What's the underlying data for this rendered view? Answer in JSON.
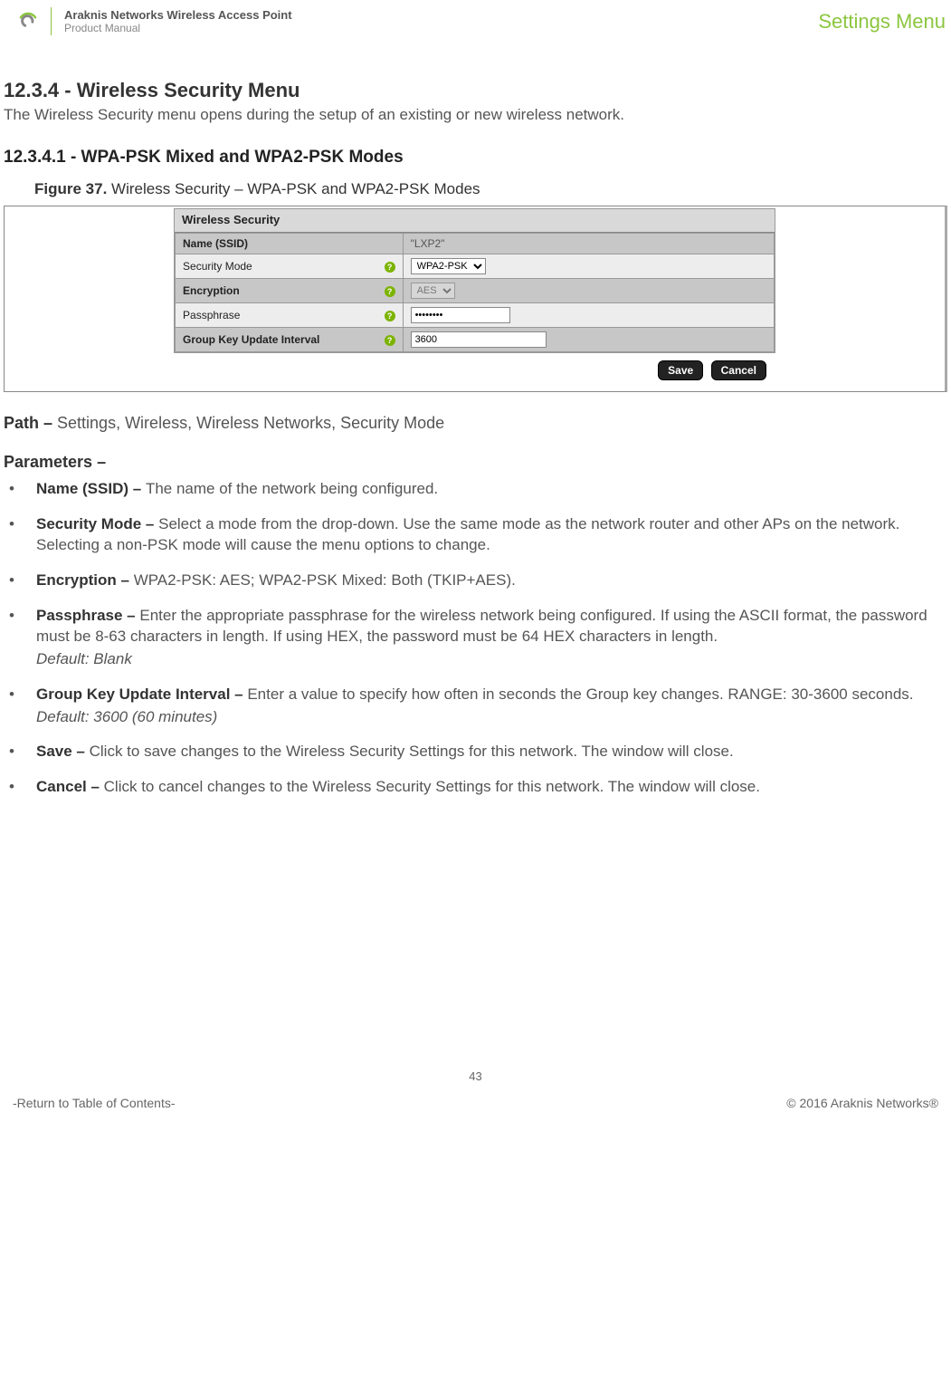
{
  "header": {
    "product_title": "Araknis Networks Wireless Access Point",
    "product_sub": "Product Manual",
    "section_label": "Settings Menu"
  },
  "section": {
    "heading": "12.3.4 - Wireless Security Menu",
    "intro": "The Wireless Security menu opens during the setup of an existing or new wireless network.",
    "sub_heading": "12.3.4.1 - WPA-PSK Mixed and WPA2-PSK Modes",
    "figure_prefix": "Figure 37.",
    "figure_caption": "Wireless Security – WPA-PSK and WPA2-PSK Modes"
  },
  "panel": {
    "title": "Wireless Security",
    "rows": {
      "ssid_label": "Name (SSID)",
      "ssid_value": "\"LXP2\"",
      "secmode_label": "Security Mode",
      "secmode_value": "WPA2-PSK",
      "enc_label": "Encryption",
      "enc_value": "AES",
      "pass_label": "Passphrase",
      "pass_value": "••••••••",
      "gku_label": "Group Key Update Interval",
      "gku_value": "3600"
    },
    "save_label": "Save",
    "cancel_label": "Cancel"
  },
  "path": {
    "prefix": "Path – ",
    "value": "Settings, Wireless, Wireless Networks, Security Mode"
  },
  "parameters_heading": "Parameters –",
  "params": {
    "ssid_b": "Name (SSID) – ",
    "ssid_t": "The name of the network being configured.",
    "sec_b": "Security Mode – ",
    "sec_t": "Select a mode from the drop-down. Use the same mode as the network router and other APs on the network. Selecting a non-PSK mode will cause the menu options to change.",
    "enc_b": "Encryption – ",
    "enc_t": "WPA2-PSK: AES; WPA2-PSK Mixed: Both (TKIP+AES).",
    "pass_b": "Passphrase – ",
    "pass_t": "Enter the appropriate passphrase for the wireless network being configured. If using the ASCII format, the password must be 8-63 characters in length. If using HEX, the password must be 64 HEX characters in length.",
    "pass_def": "Default: Blank",
    "gku_b": "Group Key Update Interval – ",
    "gku_t": "Enter a value to specify how often in seconds the Group key changes. RANGE: 30-3600 seconds.",
    "gku_def": "Default: 3600 (60 minutes)",
    "save_b": "Save – ",
    "save_t": "Click to save changes to the Wireless Security Settings for this network. The window will close.",
    "cancel_b": "Cancel – ",
    "cancel_t": "Click to cancel changes to the Wireless Security Settings for this network. The window will close."
  },
  "footer": {
    "page": "43",
    "toc": "-Return to Table of Contents-",
    "copyright": "© 2016 Araknis Networks®"
  }
}
